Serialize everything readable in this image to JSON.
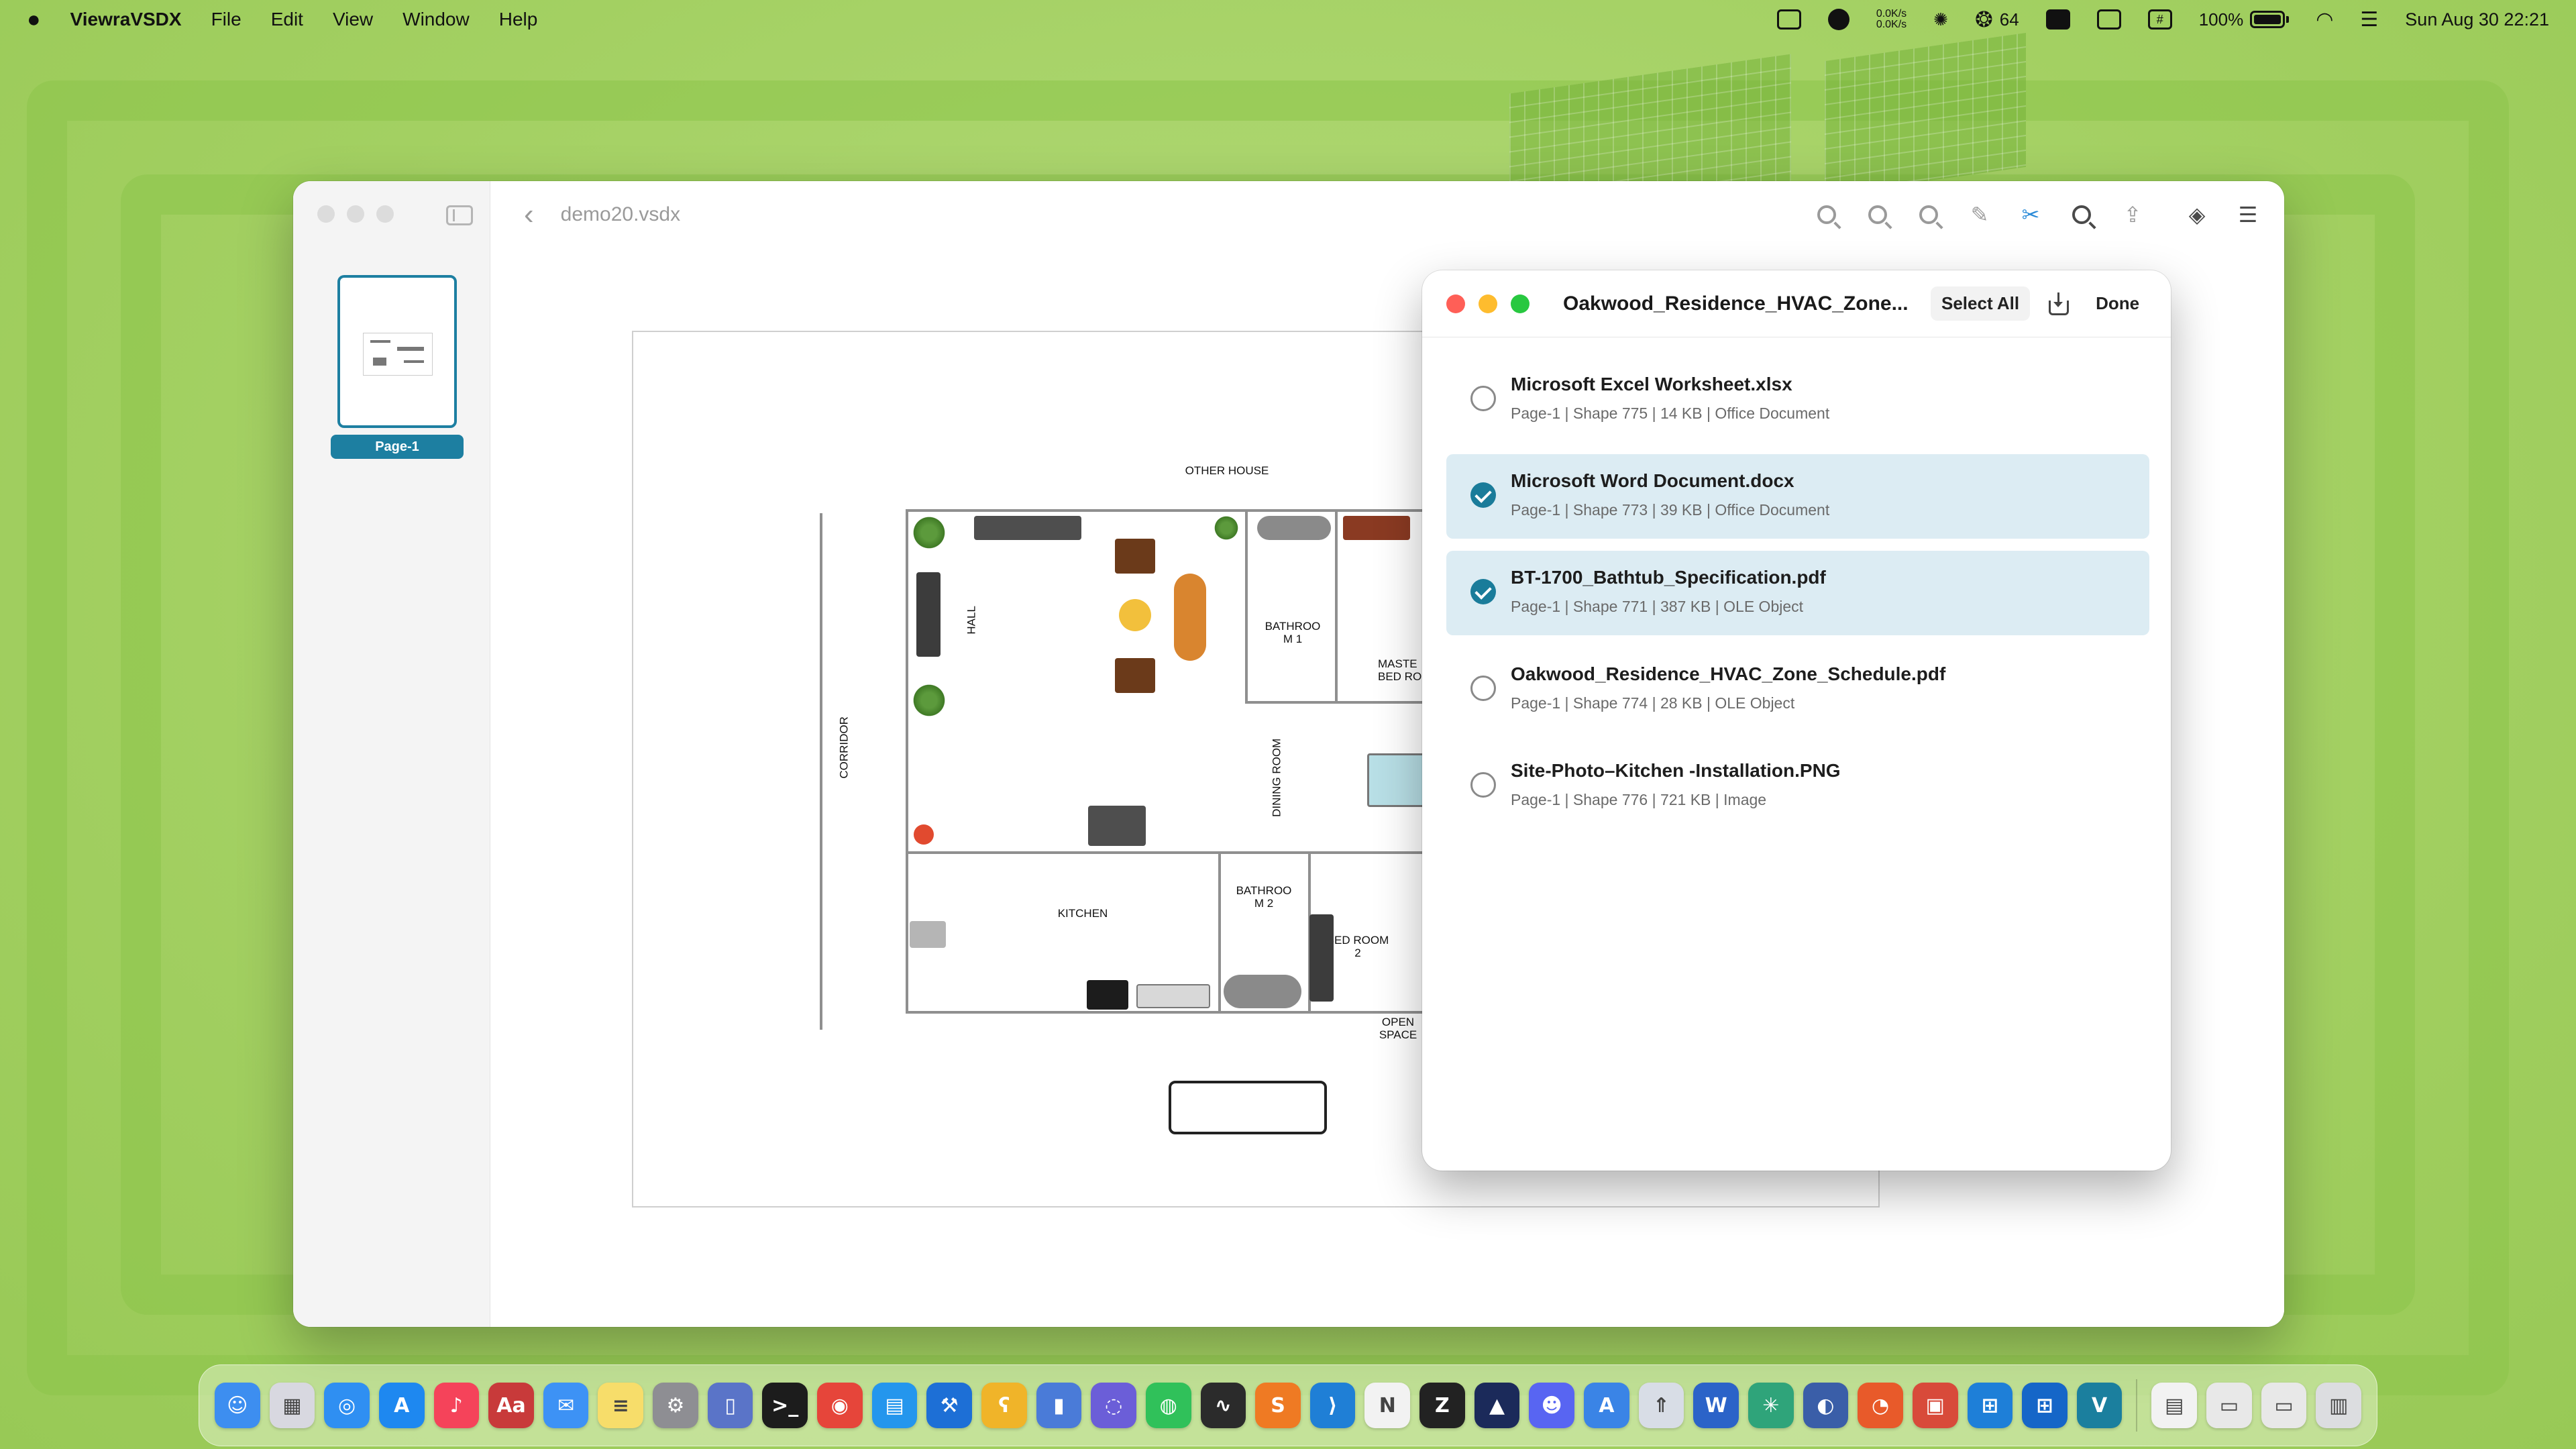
{
  "menubar": {
    "apple_icon": "apple-logo-icon",
    "app_name": "ViewraVSDX",
    "menus": [
      "File",
      "Edit",
      "View",
      "Window",
      "Help"
    ],
    "status": {
      "network_rate": "0.0K/s",
      "wechat_count": "64",
      "battery_percent": "100%",
      "datetime": "Sun Aug 30  22:21"
    }
  },
  "window": {
    "title": "demo20.vsdx",
    "back_icon": "‹",
    "page_thumbnail_label": "Page-1",
    "toolbar_icons": [
      "zoom-in-icon",
      "zoom-fit-icon",
      "zoom-out-icon",
      "markup-icon",
      "attachment-icon",
      "search-icon",
      "share-icon",
      "layers-icon",
      "settings-sliders-icon"
    ]
  },
  "floor_plan": {
    "labels": {
      "other_house": "OTHER HOUSE",
      "hall": "HALL",
      "corridor": "CORRIDOR",
      "bathroom1": "BATHROO\nM 1",
      "master_bedroom": "MASTE\nBED RO",
      "dining_room": "DINING ROOM",
      "kitchen": "KITCHEN",
      "bathroom2": "BATHROO\nM 2",
      "bedroom2": "BED ROOM\n2",
      "open_space": "OPEN\nSPACE"
    }
  },
  "attachments_panel": {
    "title": "Oakwood_Residence_HVAC_Zone...",
    "select_all_label": "Select All",
    "done_label": "Done",
    "items": [
      {
        "name": "Microsoft Excel Worksheet.xlsx",
        "meta": "Page-1 | Shape 775 | 14 KB | Office Document",
        "selected": false
      },
      {
        "name": "Microsoft Word Document.docx",
        "meta": "Page-1 | Shape 773 | 39 KB | Office Document",
        "selected": true
      },
      {
        "name": "BT-1700_Bathtub_Specification.pdf",
        "meta": "Page-1 | Shape 771 | 387 KB | OLE Object",
        "selected": true
      },
      {
        "name": "Oakwood_Residence_HVAC_Zone_Schedule.pdf",
        "meta": "Page-1 | Shape 774 | 28 KB | OLE Object",
        "selected": false
      },
      {
        "name": "Site-Photo–Kitchen -Installation.PNG",
        "meta": "Page-1 | Shape 776 | 721 KB | Image",
        "selected": false
      }
    ]
  },
  "dock": {
    "apps": [
      {
        "name": "finder-icon",
        "glyph": "☺",
        "color": "#3d8ef0"
      },
      {
        "name": "launchpad-icon",
        "glyph": "▦",
        "color": "#d8d8e0"
      },
      {
        "name": "safari-icon",
        "glyph": "◎",
        "color": "#2f8ff2"
      },
      {
        "name": "app-store-icon",
        "glyph": "A",
        "color": "#1e88f0"
      },
      {
        "name": "music-icon",
        "glyph": "♪",
        "color": "#f5435a"
      },
      {
        "name": "dictionary-icon",
        "glyph": "Aa",
        "color": "#c83a3a"
      },
      {
        "name": "mail-icon",
        "glyph": "✉",
        "color": "#3d92f5"
      },
      {
        "name": "notes-icon",
        "glyph": "≡",
        "color": "#f7dd6a"
      },
      {
        "name": "system-settings-icon",
        "glyph": "⚙",
        "color": "#8e8e93"
      },
      {
        "name": "iphone-mirroring-icon",
        "glyph": "▯",
        "color": "#5a74c8"
      },
      {
        "name": "terminal-icon",
        "glyph": ">_",
        "color": "#1c1c1c"
      },
      {
        "name": "chrome-icon",
        "glyph": "◉",
        "color": "#e6453a"
      },
      {
        "name": "docker-icon",
        "glyph": "▤",
        "color": "#2496ed"
      },
      {
        "name": "xcode-icon",
        "glyph": "⚒",
        "color": "#1d6fd6"
      },
      {
        "name": "bear-icon",
        "glyph": "ʕ",
        "color": "#f0b429"
      },
      {
        "name": "instruments-icon",
        "glyph": "▮",
        "color": "#4a7bd8"
      },
      {
        "name": "chatgpt-icon",
        "glyph": "◌",
        "color": "#6b5ed8"
      },
      {
        "name": "wechat-icon",
        "glyph": "◍",
        "color": "#30c15a"
      },
      {
        "name": "activity-monitor-icon",
        "glyph": "∿",
        "color": "#2b2b2b"
      },
      {
        "name": "sublime-text-icon",
        "glyph": "S",
        "color": "#ef7a23"
      },
      {
        "name": "vscode-icon",
        "glyph": "⟩",
        "color": "#1f7fd6"
      },
      {
        "name": "notion-icon",
        "glyph": "N",
        "color": "#f2f2f2"
      },
      {
        "name": "zed-icon",
        "glyph": "Z",
        "color": "#222222"
      },
      {
        "name": "affinity-icon",
        "glyph": "▲",
        "color": "#1b2a5a"
      },
      {
        "name": "discord-icon",
        "glyph": "☻",
        "color": "#5865f2"
      },
      {
        "name": "xcode-instruments-icon",
        "glyph": "A",
        "color": "#3a84e6"
      },
      {
        "name": "rocket-icon",
        "glyph": "⇑",
        "color": "#d8dde6"
      },
      {
        "name": "word-icon",
        "glyph": "W",
        "color": "#2b63c8"
      },
      {
        "name": "perplexity-icon",
        "glyph": "✳",
        "color": "#2fa47a"
      },
      {
        "name": "proxy-icon",
        "glyph": "◐",
        "color": "#3a5ea8"
      },
      {
        "name": "firefox-icon",
        "glyph": "◔",
        "color": "#e85a2a"
      },
      {
        "name": "remote-desktop-icon",
        "glyph": "▣",
        "color": "#d84a3a"
      },
      {
        "name": "windows-app-icon",
        "glyph": "⊞",
        "color": "#1e7fd8"
      },
      {
        "name": "windows-app-2-icon",
        "glyph": "⊞",
        "color": "#1566c8"
      },
      {
        "name": "viewra-vsdx-icon",
        "glyph": "V",
        "color": "#1b7f9e"
      }
    ],
    "recents": [
      {
        "name": "document-preview-icon",
        "glyph": "▤",
        "color": "#f2f2f2"
      },
      {
        "name": "screenshot-preview-icon",
        "glyph": "▭",
        "color": "#e8e8e8"
      },
      {
        "name": "screenshot-preview-2-icon",
        "glyph": "▭",
        "color": "#e8e8e8"
      },
      {
        "name": "trash-icon",
        "glyph": "▥",
        "color": "#dcdde0"
      }
    ]
  }
}
